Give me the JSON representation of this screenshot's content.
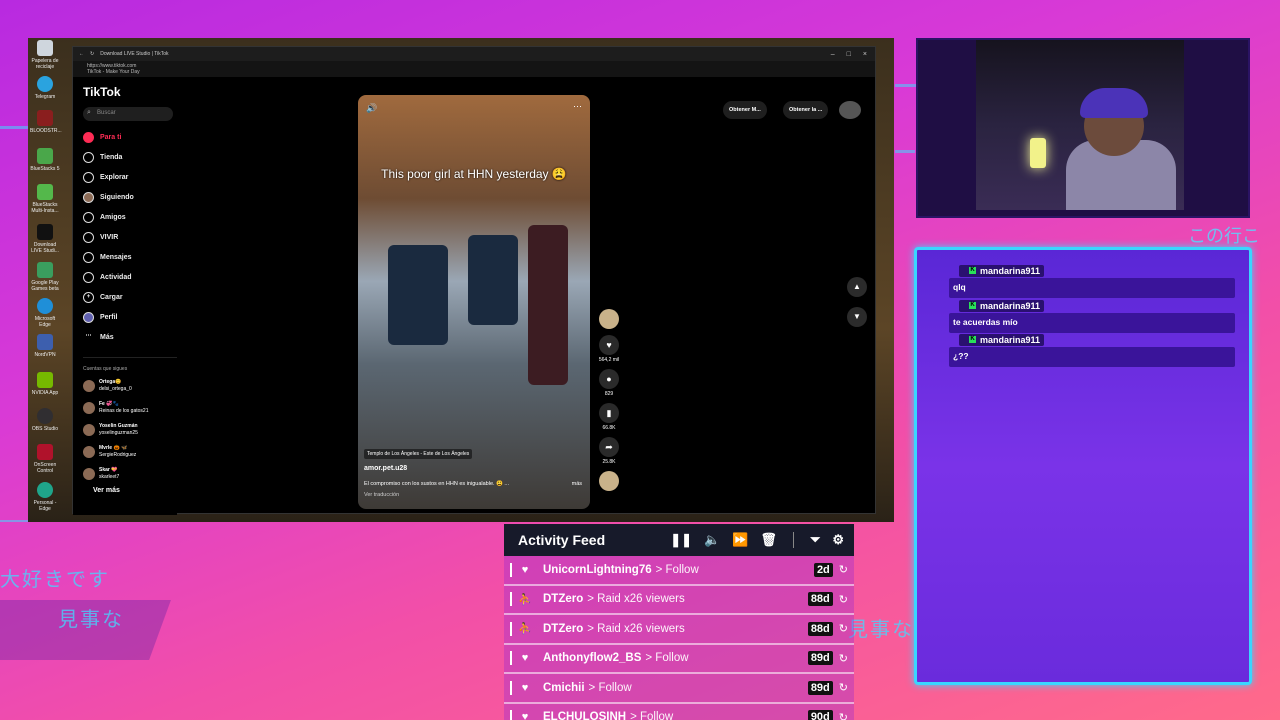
{
  "desktop": {
    "icons": [
      "Papelera de reciclaje",
      "Telegram",
      "BLOODSTR...",
      "BlueStacks 5",
      "BlueStacks Multi-Insta...",
      "Download LIVE Studi...",
      "Google Play Games beta",
      "Microsoft Edge",
      "NordVPN",
      "NVIDIA App",
      "OBS Studio",
      "OnScreen Control",
      "Personal - Edge"
    ]
  },
  "browser": {
    "tab_title": "Download LIVE Studio | TikTok",
    "url": "https://www.tiktok.com",
    "page_title": "TikTok - Make Your Day"
  },
  "tiktok": {
    "logo": "TikTok",
    "search_placeholder": "Buscar",
    "nav": [
      "Para ti",
      "Tienda",
      "Explorar",
      "Siguiendo",
      "Amigos",
      "VIVIR",
      "Mensajes",
      "Actividad",
      "Cargar",
      "Perfil",
      "Más"
    ],
    "following_header": "Cuentas que sigues",
    "following": [
      {
        "name": "Ortega😊",
        "handle": "delsi_ortega_0"
      },
      {
        "name": "Fe 💞🐾",
        "handle": "Reinas de los gatos21"
      },
      {
        "name": "Yoselin Guzmán",
        "handle": "yoselinguzman25"
      },
      {
        "name": "Mvrle 🎃 🦋",
        "handle": "SergieRodriguez"
      },
      {
        "name": "Skar 💝",
        "handle": "skarleet7"
      }
    ],
    "see_more": "Ver más",
    "top_buttons": [
      "Obtener M...",
      "Obtener la ..."
    ],
    "video": {
      "caption": "This poor girl at HHN yesterday 😩",
      "place": "Templo de Los Ángeles - Este de Los Ángeles",
      "user": "amor.pet.u28",
      "description": "El compromiso con los sustos en HHN es inigualable. 😩 ...",
      "more": "más",
      "translate": "Ver traducción"
    },
    "counts": [
      "564,2 mil",
      "829",
      "66.8K",
      "25.8K"
    ]
  },
  "chat": {
    "messages": [
      {
        "user": "mandarina911",
        "text": "qlq"
      },
      {
        "user": "mandarina911",
        "text": "te acuerdas mío"
      },
      {
        "user": "mandarina911",
        "text": "¿??"
      }
    ]
  },
  "overlay_text": [
    "大好きです",
    "見事な",
    "見事な",
    "この行こ"
  ],
  "feed": {
    "title": "Activity Feed",
    "items": [
      {
        "icon": "heart",
        "user": "UnicornLightning76",
        "action": "> Follow",
        "age": "2d"
      },
      {
        "icon": "raid",
        "user": "DTZero",
        "action": "> Raid x26 viewers",
        "age": "88d"
      },
      {
        "icon": "raid",
        "user": "DTZero",
        "action": "> Raid x26 viewers",
        "age": "88d"
      },
      {
        "icon": "heart",
        "user": "Anthonyflow2_BS",
        "action": "> Follow",
        "age": "89d"
      },
      {
        "icon": "heart",
        "user": "Cmichii",
        "action": "> Follow",
        "age": "89d"
      },
      {
        "icon": "heart",
        "user": "ELCHULOSINH",
        "action": "> Follow",
        "age": "90d"
      }
    ]
  },
  "colors": {
    "accent": "#fe2c55",
    "chat_border": "#39d6ff",
    "chat_bg": "#6a2bdc",
    "badge": "#29e05a"
  }
}
